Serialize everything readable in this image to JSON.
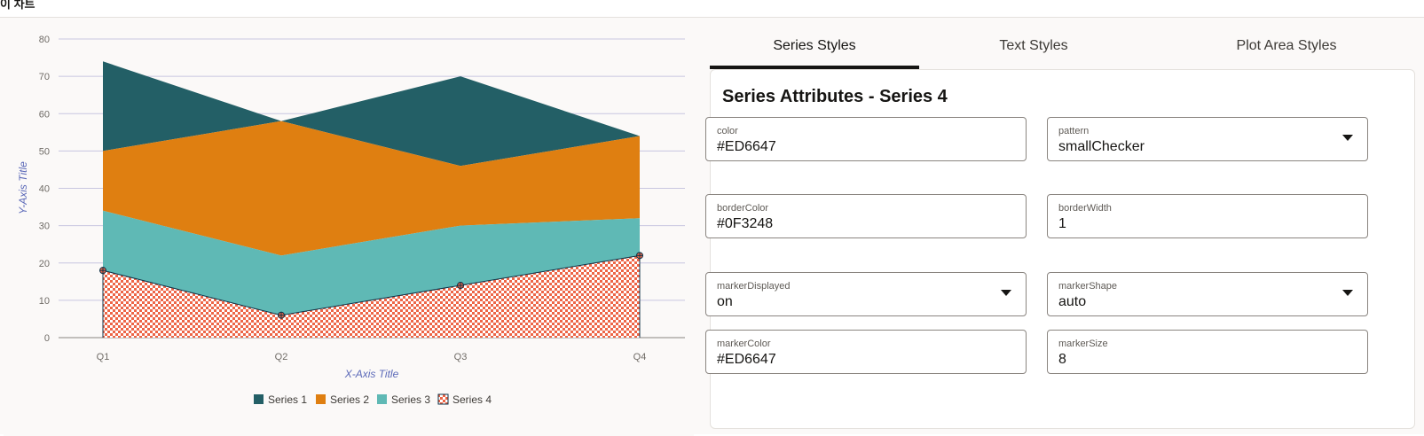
{
  "header": {
    "label": "이 차트"
  },
  "tabs": [
    {
      "label": "Series Styles",
      "active": true
    },
    {
      "label": "Text Styles",
      "active": false
    },
    {
      "label": "Plot Area Styles",
      "active": false
    }
  ],
  "panel": {
    "title": "Series Attributes - Series 4",
    "fields": {
      "color": {
        "label": "color",
        "value": "#ED6647"
      },
      "pattern": {
        "label": "pattern",
        "value": "smallChecker"
      },
      "borderColor": {
        "label": "borderColor",
        "value": "#0F3248"
      },
      "borderWidth": {
        "label": "borderWidth",
        "value": "1"
      },
      "markerDisplayed": {
        "label": "markerDisplayed",
        "value": "on"
      },
      "markerShape": {
        "label": "markerShape",
        "value": "auto"
      },
      "markerColor": {
        "label": "markerColor",
        "value": "#ED6647"
      },
      "markerSize": {
        "label": "markerSize",
        "value": "8"
      }
    }
  },
  "chart_data": {
    "type": "area",
    "stacked": true,
    "categories": [
      "Q1",
      "Q2",
      "Q3",
      "Q4"
    ],
    "series": [
      {
        "name": "Series 1",
        "values": [
          24,
          0,
          24,
          0
        ],
        "color": "#235F66"
      },
      {
        "name": "Series 2",
        "values": [
          16,
          36,
          16,
          22
        ],
        "color": "#DF7F11"
      },
      {
        "name": "Series 3",
        "values": [
          16,
          16,
          16,
          10
        ],
        "color": "#5FB9B5"
      },
      {
        "name": "Series 4",
        "values": [
          18,
          6,
          14,
          22
        ],
        "color": "#ED6647",
        "pattern": "smallChecker",
        "borderColor": "#0F3248",
        "markers": true
      }
    ],
    "xlabel": "X-Axis Title",
    "ylabel": "Y-Axis Title",
    "ylim": [
      0,
      80
    ],
    "yticks": [
      0,
      10,
      20,
      30,
      40,
      50,
      60,
      70,
      80
    ],
    "grid": true,
    "legend": "bottom"
  }
}
